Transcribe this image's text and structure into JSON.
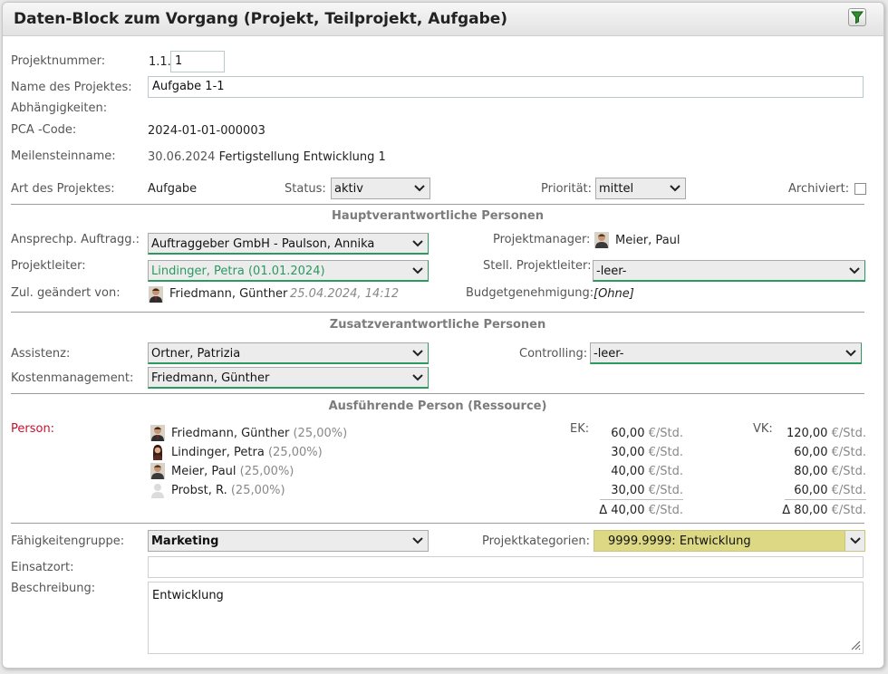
{
  "window": {
    "title": "Daten-Block zum Vorgang (Projekt, Teilprojekt, Aufgabe)",
    "filter_icon": "filter-icon"
  },
  "fields": {
    "projektnummer": {
      "label": "Projektnummer:",
      "prefix": "1.1.",
      "value": "1"
    },
    "name": {
      "label": "Name des Projektes:",
      "value": "Aufgabe 1-1"
    },
    "abhaengigkeiten": {
      "label": "Abhängigkeiten:"
    },
    "pca": {
      "label": "PCA -Code:",
      "value": "2024-01-01-000003"
    },
    "meilenstein": {
      "label": "Meilensteinname:",
      "date": "30.06.2024",
      "text": "Fertigstellung Entwicklung 1"
    },
    "art": {
      "label": "Art des Projektes:",
      "value": "Aufgabe"
    },
    "status": {
      "label": "Status:",
      "value": "aktiv"
    },
    "prioritaet": {
      "label": "Priorität:",
      "value": "mittel"
    },
    "archiviert": {
      "label": "Archiviert:",
      "checked": false
    }
  },
  "haupt": {
    "title": "Hauptverantwortliche Personen",
    "ansprech": {
      "label": "Ansprechp. Auftragg.:",
      "value": "Auftraggeber GmbH - Paulson, Annika"
    },
    "projektmanager": {
      "label": "Projektmanager:",
      "value": "Meier, Paul"
    },
    "projektleiter": {
      "label": "Projektleiter:",
      "value": "Lindinger, Petra (01.01.2024)"
    },
    "stell": {
      "label": "Stell. Projektleiter:",
      "value": "-leer-"
    },
    "zul": {
      "label": "Zul. geändert von:",
      "value": "Friedmann, Günther",
      "timestamp": "25.04.2024, 14:12"
    },
    "budget": {
      "label": "Budgetgenehmigung:",
      "value": "[Ohne]"
    }
  },
  "zusatz": {
    "title": "Zusatzverantwortliche Personen",
    "assistenz": {
      "label": "Assistenz:",
      "value": "Ortner, Patrizia"
    },
    "controlling": {
      "label": "Controlling:",
      "value": "-leer-"
    },
    "kosten": {
      "label": "Kostenmanagement:",
      "value": "Friedmann, Günther"
    }
  },
  "ressource": {
    "title": "Ausführende Person (Ressource)",
    "person_label": "Person:",
    "ek_label": "EK:",
    "vk_label": "VK:",
    "unit": "€/Std.",
    "persons": [
      {
        "name": "Friedmann, Günther",
        "pct": "(25,00%)",
        "ek": "60,00",
        "vk": "120,00"
      },
      {
        "name": "Lindinger, Petra",
        "pct": "(25,00%)",
        "ek": "30,00",
        "vk": "60,00"
      },
      {
        "name": "Meier, Paul",
        "pct": "(25,00%)",
        "ek": "40,00",
        "vk": "80,00"
      },
      {
        "name": "Probst, R.",
        "pct": "(25,00%)",
        "ek": "30,00",
        "vk": "60,00"
      }
    ],
    "ek_avg": "Δ 40,00",
    "vk_avg": "Δ 80,00"
  },
  "bottom": {
    "faehigkeit": {
      "label": "Fähigkeitengruppe:",
      "value": "Marketing"
    },
    "kategorie": {
      "label": "Projektkategorien:",
      "value": "9999.9999: Entwicklung"
    },
    "einsatzort": {
      "label": "Einsatzort:",
      "value": ""
    },
    "beschreibung": {
      "label": "Beschreibung:",
      "value": "Entwicklung"
    }
  },
  "colors": {
    "accent_green": "#2a9a60",
    "person_red": "#c8102e",
    "category_bg": "#dcd884",
    "section_text": "#7c7c7c"
  }
}
